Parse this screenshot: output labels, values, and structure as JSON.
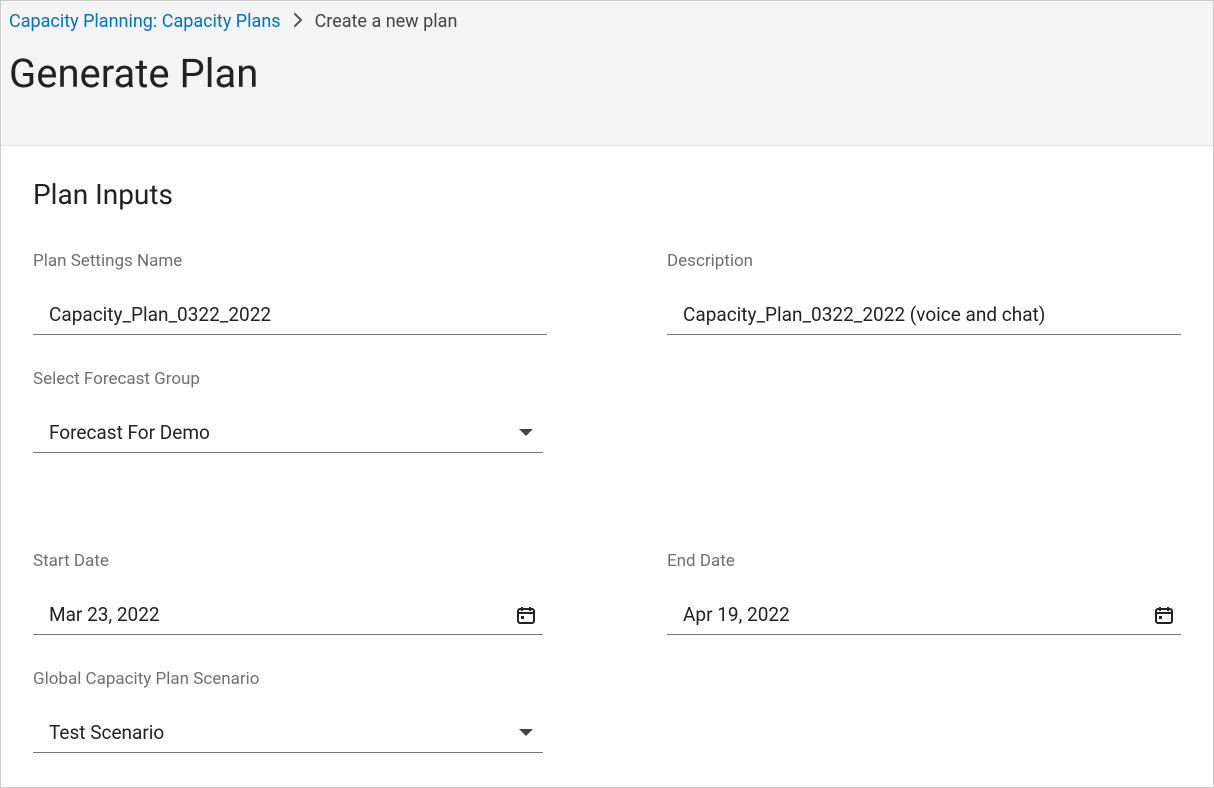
{
  "breadcrumb": {
    "root": "Capacity Planning: Capacity Plans",
    "current": "Create a new plan"
  },
  "page_title": "Generate Plan",
  "section_title": "Plan Inputs",
  "fields": {
    "plan_name": {
      "label": "Plan Settings Name",
      "value": "Capacity_Plan_0322_2022"
    },
    "description": {
      "label": "Description",
      "value": "Capacity_Plan_0322_2022 (voice and chat)"
    },
    "forecast_group": {
      "label": "Select Forecast Group",
      "value": "Forecast For Demo"
    },
    "start_date": {
      "label": "Start Date",
      "value": "Mar 23, 2022"
    },
    "end_date": {
      "label": "End Date",
      "value": "Apr 19, 2022"
    },
    "scenario": {
      "label": "Global Capacity Plan Scenario",
      "value": "Test Scenario"
    }
  }
}
